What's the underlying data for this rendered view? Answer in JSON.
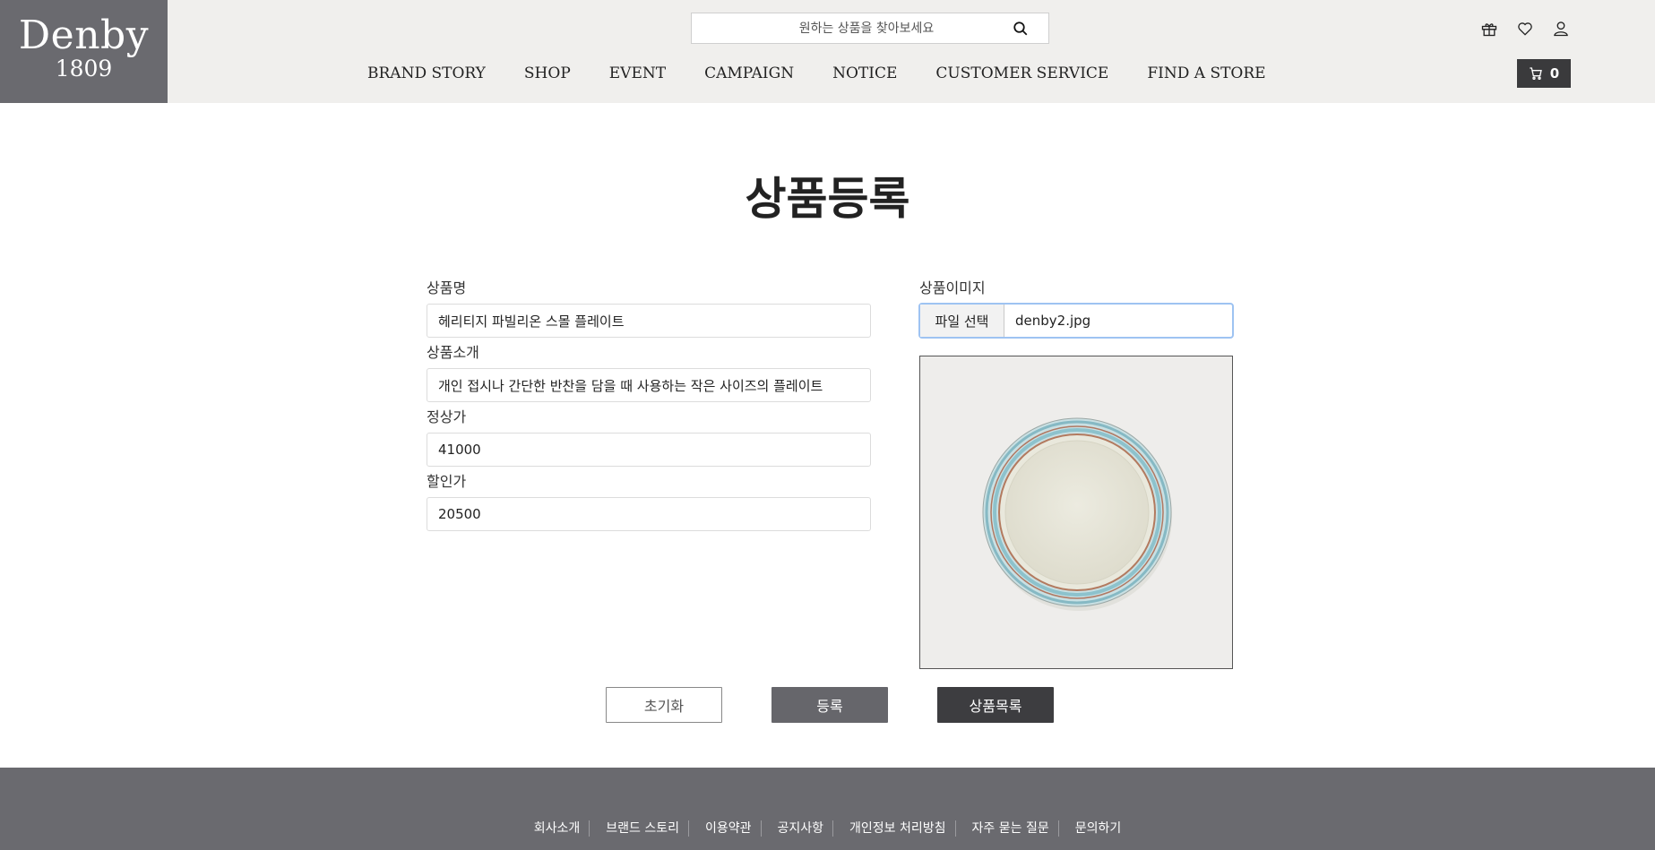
{
  "header": {
    "logo_name": "Denby",
    "logo_year": "1809",
    "search_placeholder": "원하는 상품을 찾아보세요",
    "nav": [
      "BRAND STORY",
      "SHOP",
      "EVENT",
      "CAMPAIGN",
      "NOTICE",
      "CUSTOMER SERVICE",
      "FIND A STORE"
    ],
    "cart_count": "0",
    "icons": [
      "gift-icon",
      "heart-icon",
      "user-icon",
      "cart-icon",
      "search-icon"
    ]
  },
  "main": {
    "title": "상품등록",
    "fields": {
      "name_label": "상품명",
      "name_value": "헤리티지 파빌리온 스몰 플레이트",
      "desc_label": "상품소개",
      "desc_value": "개인 접시나 간단한 반찬을 담을 때 사용하는 작은 사이즈의 플레이트",
      "price_label": "정상가",
      "price_value": "41000",
      "sale_label": "할인가",
      "sale_value": "20500"
    },
    "image": {
      "label": "상품이미지",
      "file_button": "파일 선택",
      "file_name": "denby2.jpg"
    },
    "buttons": {
      "reset": "초기화",
      "submit": "등록",
      "list": "상품목록"
    }
  },
  "footer": {
    "links": [
      "회사소개",
      "브랜드 스토리",
      "이용약관",
      "공지사항",
      "개인정보 처리방침",
      "자주 묻는 질문",
      "문의하기"
    ]
  },
  "colors": {
    "header_bg": "#f0efed",
    "logo_bg": "#6a6a6f",
    "footer_bg": "#6a6a6f",
    "submit_bg": "#66666b",
    "list_bg": "#3d3d40"
  }
}
